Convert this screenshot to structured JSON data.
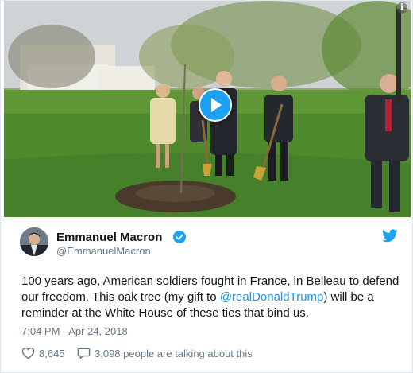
{
  "tweet": {
    "author": {
      "display_name": "Emmanuel Macron",
      "handle": "@EmmanuelMacron",
      "verified": true,
      "avatar_icon": "avatar-portrait"
    },
    "text_parts": {
      "before_mention": "100 years ago, American soldiers fought in France, in Belleau to defend our freedom. This oak tree (my gift to ",
      "mention": "@realDonaldTrump",
      "after_mention": ") will be a reminder at the White House of these ties that bind us."
    },
    "timestamp": "7:04 PM - Apr 24, 2018",
    "likes": "8,645",
    "talking": "3,098 people are talking about this"
  },
  "media": {
    "type": "video",
    "play_icon": "play-icon",
    "info_icon_glyph": "i"
  },
  "icons": {
    "brand": "twitter-bird-icon",
    "verified": "verified-badge-icon",
    "like": "heart-icon",
    "talking": "comment-icon"
  },
  "colors": {
    "brand_blue": "#1da1f2",
    "link_blue": "#1b95e0",
    "secondary_text": "#657786",
    "primary_text": "#14171a"
  }
}
